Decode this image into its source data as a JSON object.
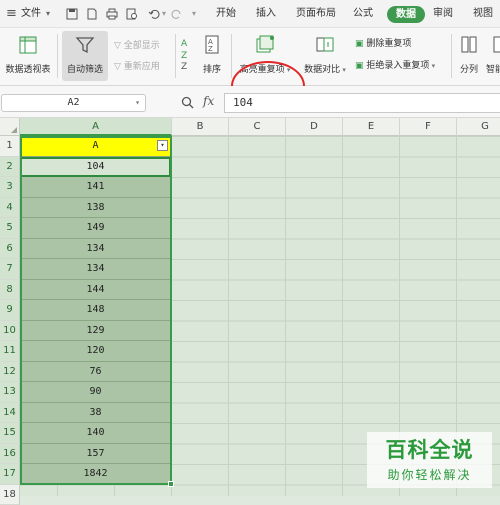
{
  "titlebar": {
    "menu_file": "文件",
    "tabs": [
      "开始",
      "插入",
      "页面布局",
      "公式",
      "数据",
      "审阅",
      "视图"
    ],
    "active_tab": "数据"
  },
  "ribbon": {
    "pivot_table": "数据透视表",
    "auto_filter": "自动筛选",
    "show_all": "全部显示",
    "reapply": "重新应用",
    "sort": "排序",
    "highlight_duplicates": "高亮重复项",
    "data_compare": "数据对比",
    "remove_duplicates": "删除重复项",
    "reject_duplicates": "拒绝录入重复项",
    "split": "分列",
    "smart": "智能"
  },
  "formula_bar": {
    "name_box": "A2",
    "fx_label": "fx",
    "value": "104"
  },
  "grid": {
    "columns": [
      "A",
      "B",
      "C",
      "D",
      "E",
      "F",
      "G"
    ],
    "rows": [
      "1",
      "2",
      "3",
      "4",
      "5",
      "6",
      "7",
      "8",
      "9",
      "10",
      "11",
      "12",
      "13",
      "14",
      "15",
      "16",
      "17",
      "18"
    ],
    "column_a_header": "A",
    "column_a_values": [
      "104",
      "141",
      "138",
      "149",
      "134",
      "134",
      "144",
      "148",
      "129",
      "120",
      "76",
      "90",
      "38",
      "140",
      "157",
      "1842"
    ]
  },
  "watermark": {
    "title": "百科全说",
    "subtitle": "助你轻松解决"
  },
  "colors": {
    "accent": "#3f9a4f",
    "header_cell": "#ffff00",
    "selection": "#abc4a6",
    "annotation_circle": "#e32626"
  }
}
